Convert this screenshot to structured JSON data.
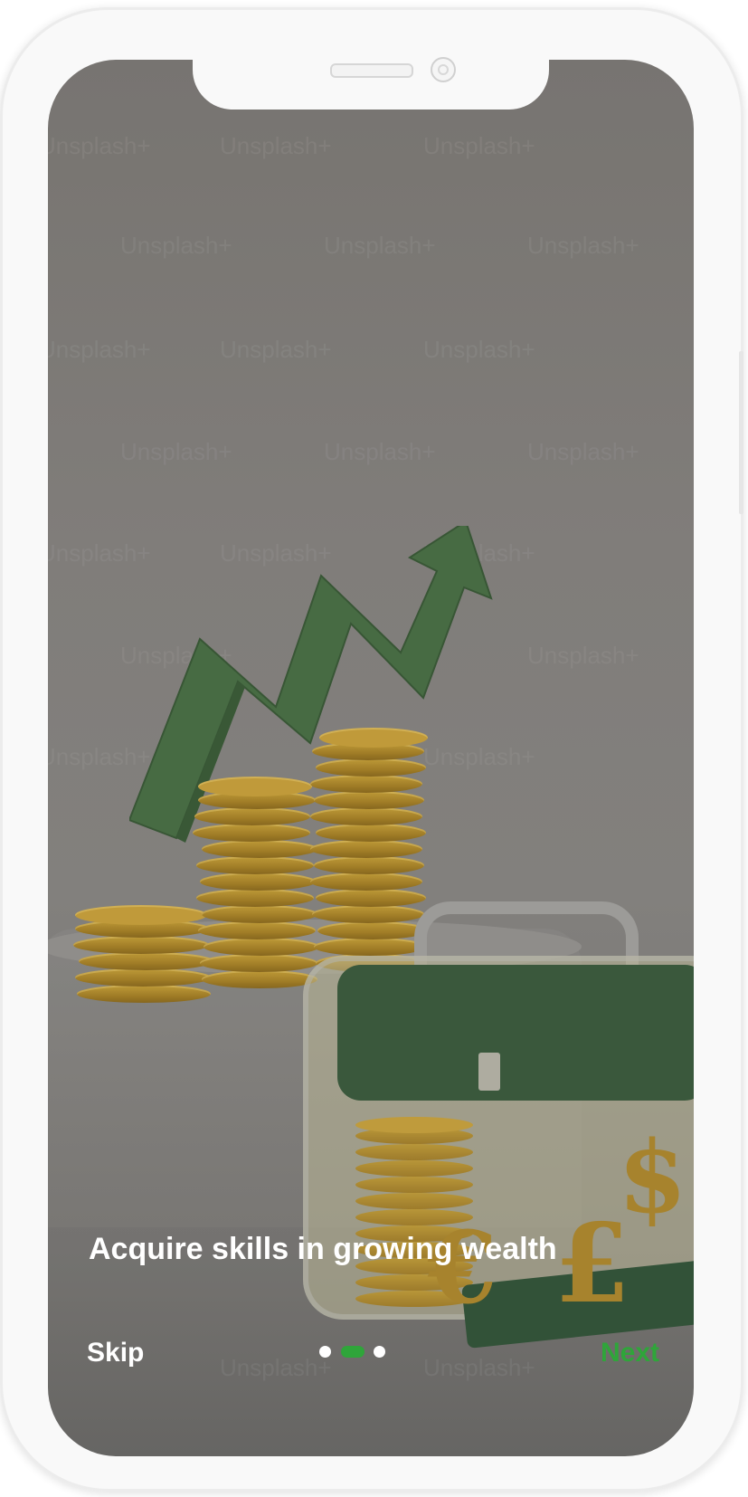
{
  "onboarding": {
    "headline": "Acquire skills in growing wealth",
    "skip_label": "Skip",
    "next_label": "Next",
    "page_indicator": {
      "total": 3,
      "current": 2
    },
    "background_image": {
      "watermark_text": "Unsplash+"
    }
  },
  "colors": {
    "accent": "#2fa53a",
    "text_on_image": "#ffffff",
    "device_frame": "#f9f9f9"
  },
  "icons": {
    "device_speaker": "speaker-grille-icon",
    "device_camera": "front-camera-icon"
  }
}
